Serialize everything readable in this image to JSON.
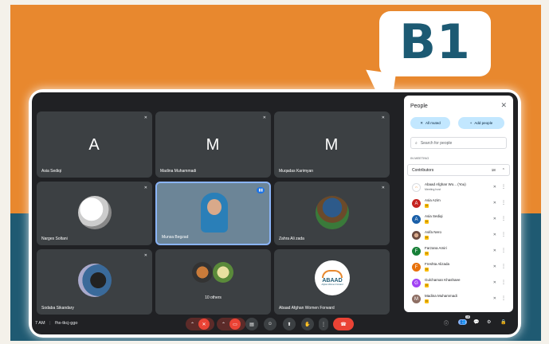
{
  "badge": {
    "text": "B1"
  },
  "tiles": [
    {
      "name": "Asia Sediqi",
      "initial": "A",
      "color": "#1a5fa8"
    },
    {
      "name": "Madina Muhammadi",
      "initial": "M",
      "color": "#8d6e63"
    },
    {
      "name": "Muqadas Karimyan",
      "initial": "M",
      "color": "#1a5fa8"
    },
    {
      "name": "Narges Soltani"
    },
    {
      "name": "Munsa Begzad"
    },
    {
      "name": "Zahra Ali zada"
    },
    {
      "name": "Sodaba Sikandary"
    },
    {
      "name": "10 others"
    },
    {
      "name": "Abaad Afghan Women Forward",
      "logo_text": "ABAAD",
      "logo_sub": "Afghan Women Forward"
    }
  ],
  "sidebar": {
    "title": "People",
    "all_muted": "All muted",
    "add_people": "Add people",
    "search_placeholder": "Search for people",
    "section": "IN MEETING",
    "contributors_label": "Contributors",
    "contributors_count": "18",
    "people": [
      {
        "name": "Abaad Afghan Wo... (You)",
        "sub": "Meeting host",
        "initial": "",
        "color": "#ffffff"
      },
      {
        "name": "Asia Azim",
        "initial": "A",
        "color": "#c5221f"
      },
      {
        "name": "Asia Sediqi",
        "initial": "A",
        "color": "#1a5fa8"
      },
      {
        "name": "Asifa Nero",
        "initial": "",
        "color": "#6d4c41"
      },
      {
        "name": "Farzana Amiri",
        "initial": "F",
        "color": "#188038"
      },
      {
        "name": "Freshta Alizada",
        "initial": "F",
        "color": "#e8710a"
      },
      {
        "name": "Gulchaman Khashaee",
        "initial": "G",
        "color": "#a142f4"
      },
      {
        "name": "Madina Muhammadi",
        "initial": "M",
        "color": "#8d6e63"
      }
    ]
  },
  "footer": {
    "time": "7 AM",
    "code": "fhx-tkcj-ggo",
    "participants_count": "18"
  }
}
